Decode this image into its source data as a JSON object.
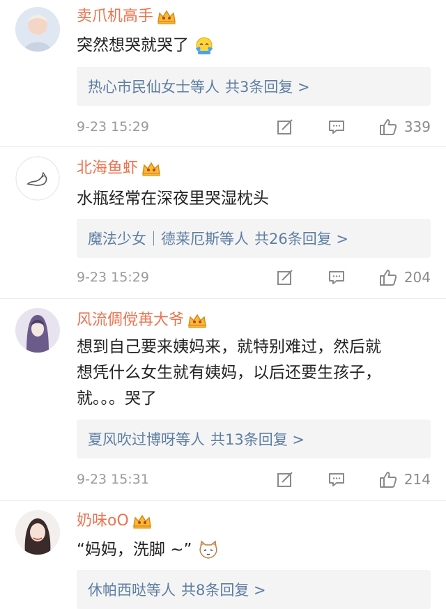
{
  "comments": [
    {
      "name": "卖爪机高手",
      "text": "突然想哭就哭了",
      "emoji": "crying-emoji",
      "reply_users": "热心市民仙女士等人",
      "reply_count": "共3条回复 >",
      "time": "9-23 15:29",
      "likes": "339"
    },
    {
      "name": "北海鱼虾",
      "text": "水瓶经常在深夜里哭湿枕头",
      "reply_users": "魔法少女｜德莱厄斯等人",
      "reply_count": "共26条回复 >",
      "time": "9-23 15:29",
      "likes": "204"
    },
    {
      "name": "风流倜傥苒大爷",
      "text_lines": [
        "想到自己要来姨妈来，就特别难过，然后就",
        "想凭什么女生就有姨妈，以后还要生孩子，",
        "就。。。哭了"
      ],
      "reply_users": "夏风吹过博呀等人",
      "reply_count": "共13条回复 >",
      "time": "9-23 15:31",
      "likes": "214"
    },
    {
      "name": "奶味oO",
      "text": "“妈妈，洗脚 ~”",
      "emoji": "cat-emoji",
      "reply_users": "休帕西哒等人",
      "reply_count": "共8条回复 >"
    }
  ],
  "icons": {
    "crown": "crown-badge-icon",
    "share": "share-edit-icon",
    "comment": "comment-bubble-icon",
    "like": "thumbs-up-icon"
  },
  "colors": {
    "name": "#eb7350",
    "reply_link": "#5d7ea3",
    "reply_bg": "#f4f4f4",
    "meta": "#9a9a9a"
  }
}
